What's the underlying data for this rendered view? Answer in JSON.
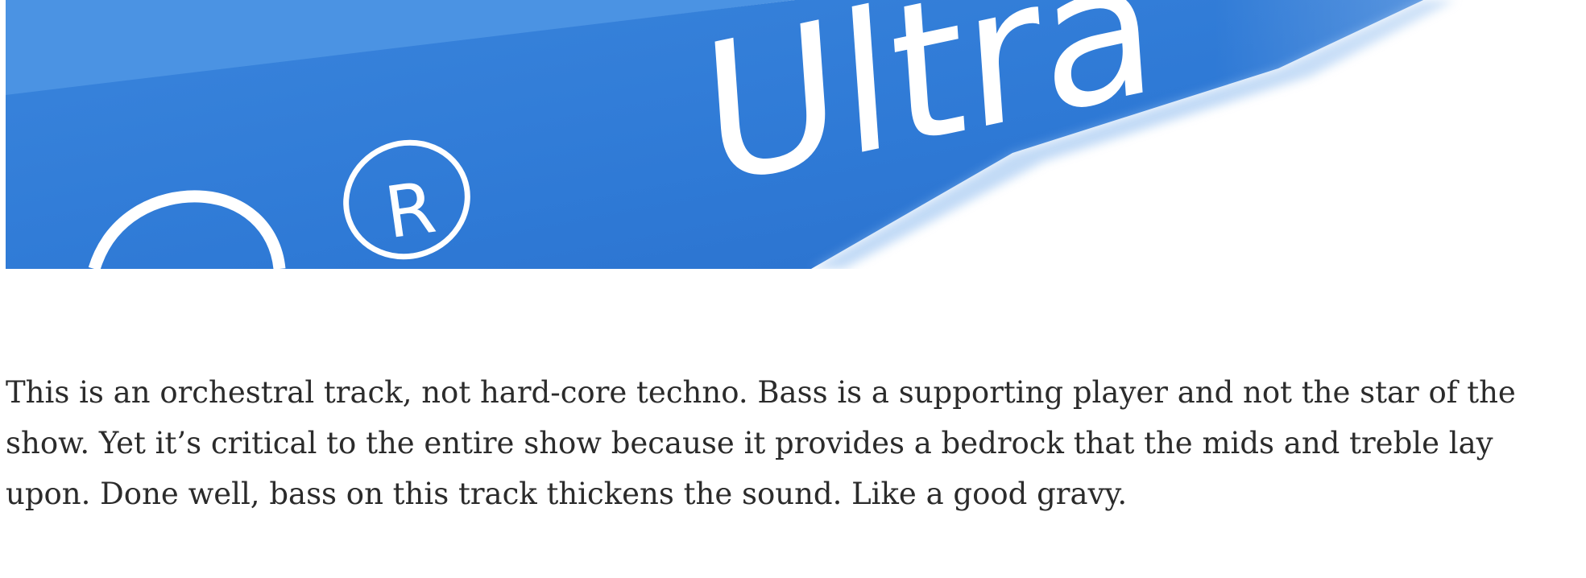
{
  "hero_image": {
    "brand_word": "Ultra",
    "registered_mark": "R",
    "colors": {
      "band": "#2f7ad6",
      "band_light": "#5a9ae6",
      "band_dark": "#1f63bf",
      "white": "#ffffff"
    }
  },
  "article": {
    "paragraph_1": {
      "lines": [
        "This is an orchestral track, not hard-core techno. Bass is a supporting player and not the star of the",
        "show. Yet it’s critical to the entire show because it provides a bedrock that the mids and treble lay",
        "upon. Done well, bass on this track thickens the sound. Like a good gravy."
      ]
    }
  }
}
